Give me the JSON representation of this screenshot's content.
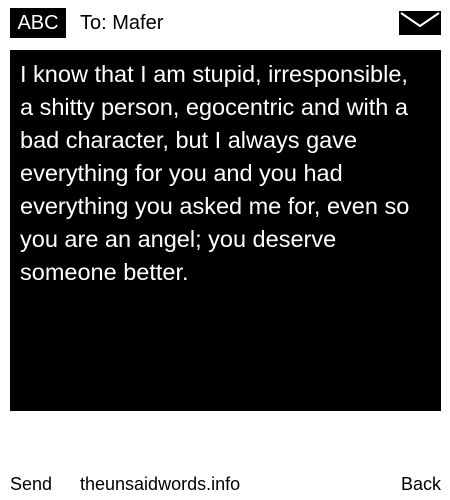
{
  "header": {
    "badge": "ABC",
    "to_label": "To: Mafer",
    "icon": "envelope-icon"
  },
  "message": {
    "text": "I know that I am stupid, irresponsible, a shitty person, egocentric and with a bad character, but I always gave everything for you and you had everything you asked me for, even so you are an angel; you deserve someone better."
  },
  "footer": {
    "send_label": "Send",
    "site_label": "theunsaidwords.info",
    "back_label": "Back"
  },
  "colors": {
    "background": "#ffffff",
    "message_background": "#000000",
    "message_text": "#ffffff",
    "text": "#000000"
  }
}
